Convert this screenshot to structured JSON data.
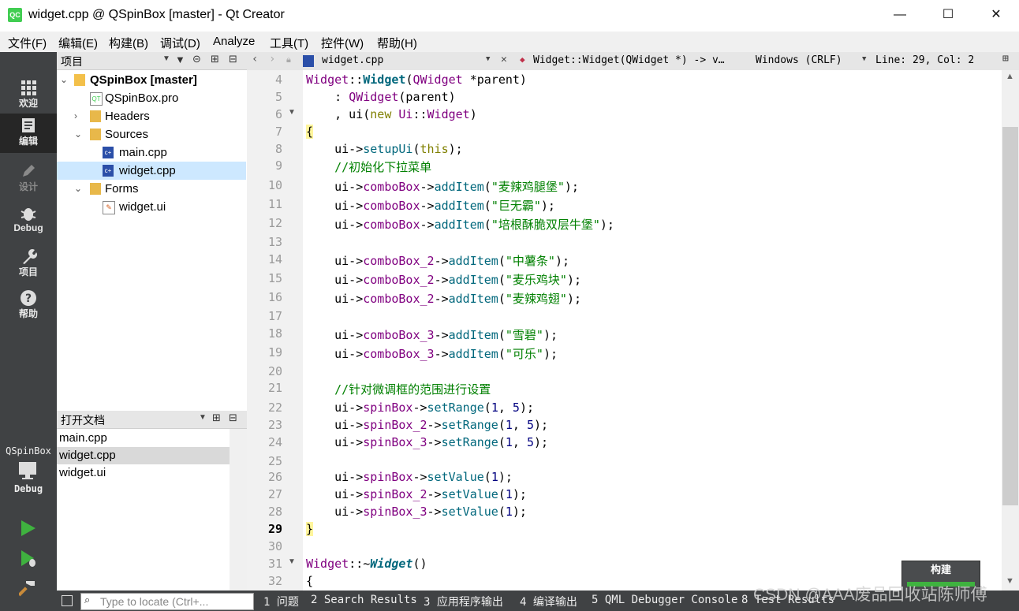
{
  "window": {
    "title": "widget.cpp @ QSpinBox [master] - Qt Creator",
    "app_icon_text": "QC",
    "minimize_glyph": "—",
    "maximize_glyph": "☐",
    "close_glyph": "✕"
  },
  "menubar": [
    "文件(F)",
    "编辑(E)",
    "构建(B)",
    "调试(D)",
    "Analyze",
    "工具(T)",
    "控件(W)",
    "帮助(H)"
  ],
  "modes": [
    {
      "label": "欢迎",
      "icon": "grid-icon"
    },
    {
      "label": "编辑",
      "icon": "edit-doc-icon"
    },
    {
      "label": "设计",
      "icon": "pencil-icon"
    },
    {
      "label": "Debug",
      "icon": "bug-icon"
    },
    {
      "label": "项目",
      "icon": "wrench-icon"
    },
    {
      "label": "帮助",
      "icon": "help-icon"
    }
  ],
  "target": {
    "project": "QSpinBox",
    "config": "Debug"
  },
  "project_pane": {
    "header": "项目",
    "tree": [
      {
        "label": "QSpinBox [master]",
        "level": 0,
        "expanded": true
      },
      {
        "label": "QSpinBox.pro",
        "level": 1
      },
      {
        "label": "Headers",
        "level": 1,
        "expanded": false
      },
      {
        "label": "Sources",
        "level": 1,
        "expanded": true
      },
      {
        "label": "main.cpp",
        "level": 2
      },
      {
        "label": "widget.cpp",
        "level": 2,
        "selected": true
      },
      {
        "label": "Forms",
        "level": 1,
        "expanded": true
      },
      {
        "label": "widget.ui",
        "level": 2
      }
    ]
  },
  "open_docs": {
    "header": "打开文档",
    "items": [
      "main.cpp",
      "widget.cpp",
      "widget.ui"
    ],
    "selected": "widget.cpp"
  },
  "editor": {
    "file": "widget.cpp",
    "symbol": "Widget::Widget(QWidget *) -> v…",
    "line_ending": "Windows (CRLF)",
    "position": "Line: 29, Col: 2"
  },
  "code": {
    "line_numbers": [
      "4",
      "5",
      "6",
      "7",
      "8",
      "9",
      "10",
      "11",
      "12",
      "13",
      "14",
      "15",
      "16",
      "17",
      "18",
      "19",
      "20",
      "21",
      "22",
      "23",
      "24",
      "25",
      "26",
      "27",
      "28",
      "29",
      "30",
      "31",
      "32"
    ],
    "current_line": "29"
  },
  "locator_placeholder": "Type to locate (Ctrl+...",
  "build_button": "构建",
  "output_tabs": [
    "1 问题",
    "2 Search Results",
    "3 应用程序输出",
    "4 编译输出",
    "5 QML Debugger Console",
    "8 Test Results"
  ],
  "watermark": "CSDN @AAA废品回收站陈师傅",
  "colors": {
    "modebar": "#404244",
    "selection": "#cde8ff",
    "keyword": "#808000",
    "type": "#800080",
    "function": "#00677c",
    "string": "#008000",
    "run_green": "#3fb23f"
  }
}
